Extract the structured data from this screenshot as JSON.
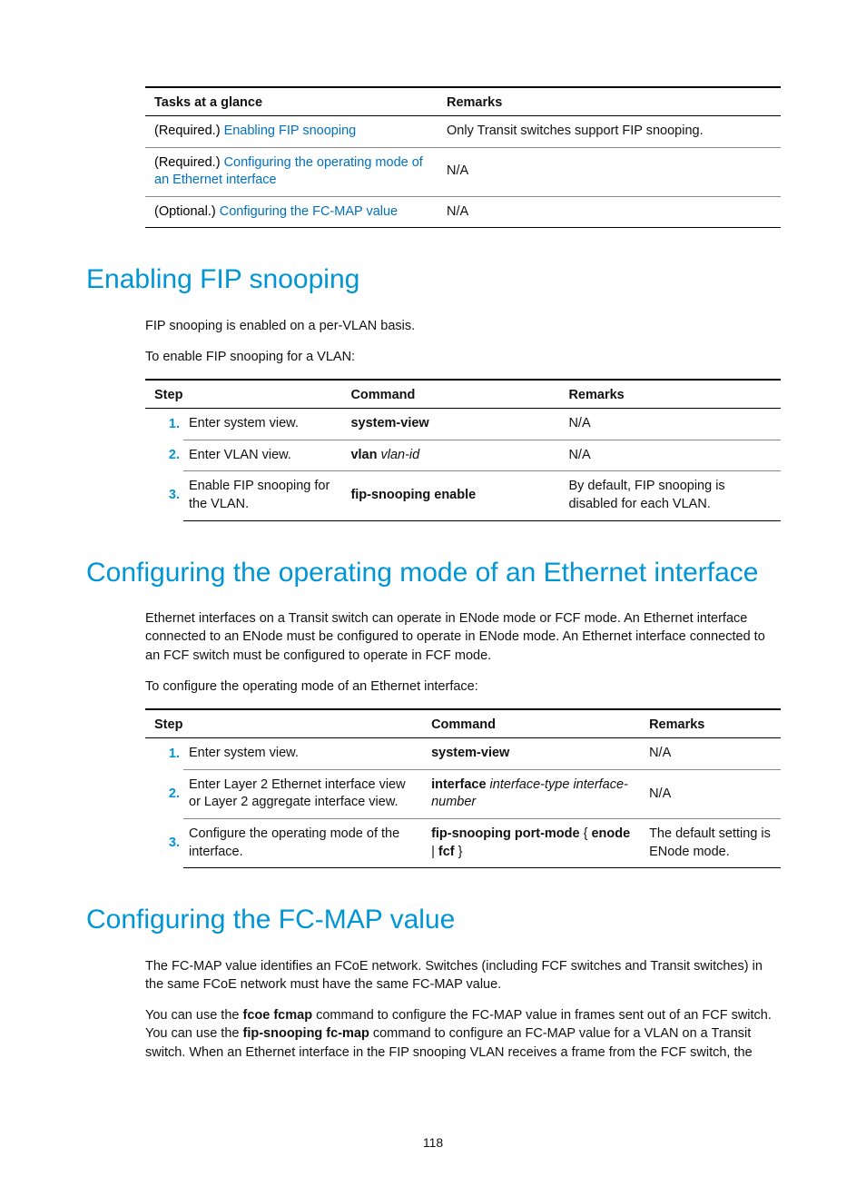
{
  "tasks_table": {
    "headers": {
      "tasks": "Tasks at a glance",
      "remarks": "Remarks"
    },
    "rows": [
      {
        "prefix": "(Required.) ",
        "link": "Enabling FIP snooping",
        "remark": "Only Transit switches support FIP snooping."
      },
      {
        "prefix": "(Required.) ",
        "link": "Configuring the operating mode of an Ethernet interface",
        "remark": "N/A"
      },
      {
        "prefix": "(Optional.) ",
        "link": "Configuring the FC-MAP value",
        "remark": "N/A"
      }
    ]
  },
  "heading1": "Enabling FIP snooping",
  "para1a": "FIP snooping is enabled on a per-VLAN basis.",
  "para1b": "To enable FIP snooping for a VLAN:",
  "step_table1": {
    "headers": {
      "step": "Step",
      "command": "Command",
      "remarks": "Remarks"
    },
    "rows": [
      {
        "n": "1.",
        "desc": "Enter system view.",
        "cmd_bold": "system-view",
        "cmd_ital": "",
        "remark": "N/A"
      },
      {
        "n": "2.",
        "desc": "Enter VLAN view.",
        "cmd_bold": "vlan",
        "cmd_ital": " vlan-id",
        "remark": "N/A"
      },
      {
        "n": "3.",
        "desc": "Enable FIP snooping for the VLAN.",
        "cmd_bold": "fip-snooping enable",
        "cmd_ital": "",
        "remark": "By default, FIP snooping is disabled for each VLAN."
      }
    ]
  },
  "heading2": "Configuring the operating mode of an Ethernet interface",
  "para2a": "Ethernet interfaces on a Transit switch can operate in ENode mode or FCF mode. An Ethernet interface connected to an ENode must be configured to operate in ENode mode. An Ethernet interface connected to an FCF switch must be configured to operate in FCF mode.",
  "para2b": "To configure the operating mode of an Ethernet interface:",
  "step_table2": {
    "headers": {
      "step": "Step",
      "command": "Command",
      "remarks": "Remarks"
    },
    "rows": [
      {
        "n": "1.",
        "desc": "Enter system view.",
        "cmd_bold": "system-view",
        "cmd_ital": "",
        "remark": "N/A"
      },
      {
        "n": "2.",
        "desc": "Enter Layer 2 Ethernet interface view or Layer 2 aggregate interface view.",
        "cmd_bold": "interface",
        "cmd_ital": " interface-type interface-number",
        "remark": "N/A"
      },
      {
        "n": "3.",
        "desc": "Configure the operating mode of the interface.",
        "cmd_bold": "fip-snooping port-mode",
        "cmd_ital": "",
        "cmd_tail": " { enode | fcf }",
        "cmd_tail_bold_parts": [
          "enode",
          "fcf"
        ],
        "remark": "The default setting is ENode mode."
      }
    ]
  },
  "heading3": "Configuring the FC-MAP value",
  "para3a": "The FC-MAP value identifies an FCoE network. Switches (including FCF switches and Transit switches) in the same FCoE network must have the same FC-MAP value.",
  "para3b_pre": "You can use the ",
  "para3b_b1": "fcoe fcmap",
  "para3b_mid": " command to configure the FC-MAP value in frames sent out of an FCF switch. You can use the ",
  "para3b_b2": "fip-snooping fc-map",
  "para3b_post": " command to configure an FC-MAP value for a VLAN on a Transit switch. When an Ethernet interface in the FIP snooping VLAN receives a frame from the FCF switch, the",
  "page_number": "118"
}
